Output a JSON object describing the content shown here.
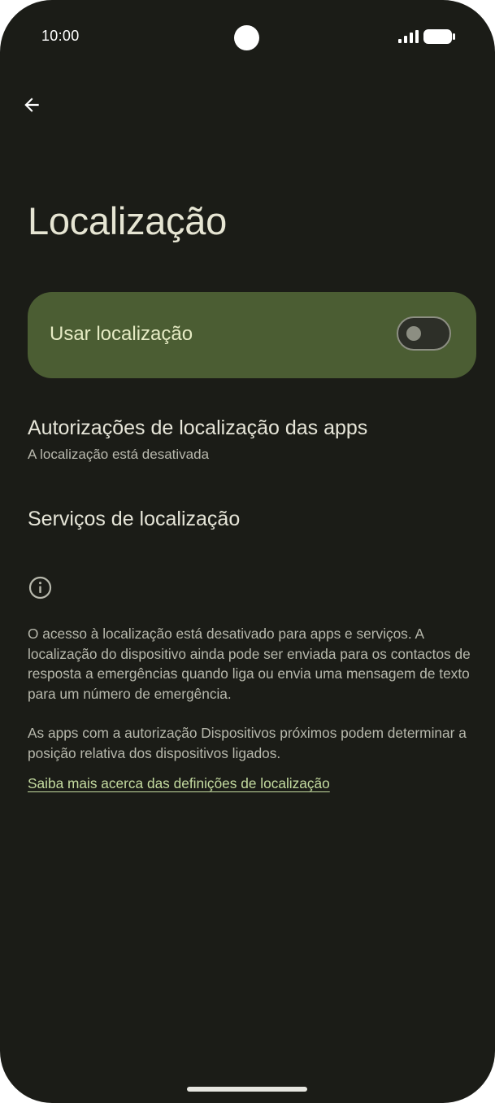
{
  "status_bar": {
    "time": "10:00",
    "icons": [
      "camera-cutout",
      "signal-icon",
      "battery-icon"
    ]
  },
  "toolbar": {
    "back_icon": "arrow-left-icon"
  },
  "page": {
    "title": "Localização"
  },
  "main_switch": {
    "label": "Usar localização",
    "checked": false
  },
  "preferences": [
    {
      "title": "Autorizações de localização das apps",
      "summary": "A localização está desativada"
    },
    {
      "title": "Serviços de localização"
    }
  ],
  "footer": {
    "icon": "info-icon",
    "paragraph_1": "O acesso à localização está desativado para apps e serviços. A localização do dispositivo ainda pode ser enviada para os contactos de resposta a emergências quando liga ou envia uma mensagem de texto para um número de emergência.",
    "paragraph_2": "As apps com a autorização Dispositivos próximos podem determinar a posição relativa dos dispositivos ligados.",
    "learn_more": "Saiba mais acerca das definições de localização"
  },
  "colors": {
    "background": "#1b1c17",
    "card": "#4b5d33",
    "card_text": "#e6ebc4",
    "link": "#c4dba0"
  }
}
